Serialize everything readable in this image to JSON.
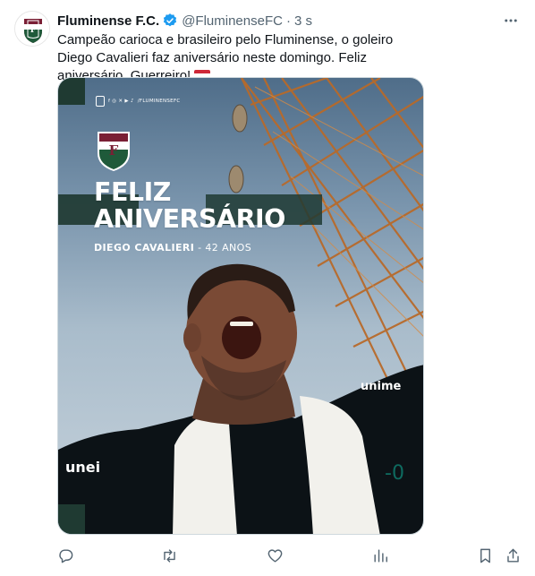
{
  "tweet": {
    "author": {
      "display_name": "Fluminense F.C.",
      "handle": "@FluminenseFC",
      "verified": true,
      "verified_color": "#1d9bf0"
    },
    "separator": "·",
    "time": "3 s",
    "more_icon": "more-dots-icon",
    "text": "Campeão carioca e brasileiro pelo Fluminense, o goleiro Diego Cavalieri faz aniversário neste domingo. Feliz aniversário, Guerreiro!",
    "emoji": "hungary-flag-emoji",
    "media": {
      "social_handle": "/FLUMINENSEFC",
      "headline_line1": "Feliz",
      "headline_line2": "Aniversário",
      "subline_name": "DIEGO CAVALIERI",
      "subline_age": " - 42 ANOS",
      "club_colors": [
        "#7a1f35",
        "#ffffff",
        "#1f5a3a"
      ]
    },
    "actions": [
      "reply-icon",
      "retweet-icon",
      "like-icon",
      "views-icon",
      "bookmark-icon",
      "share-icon"
    ]
  }
}
